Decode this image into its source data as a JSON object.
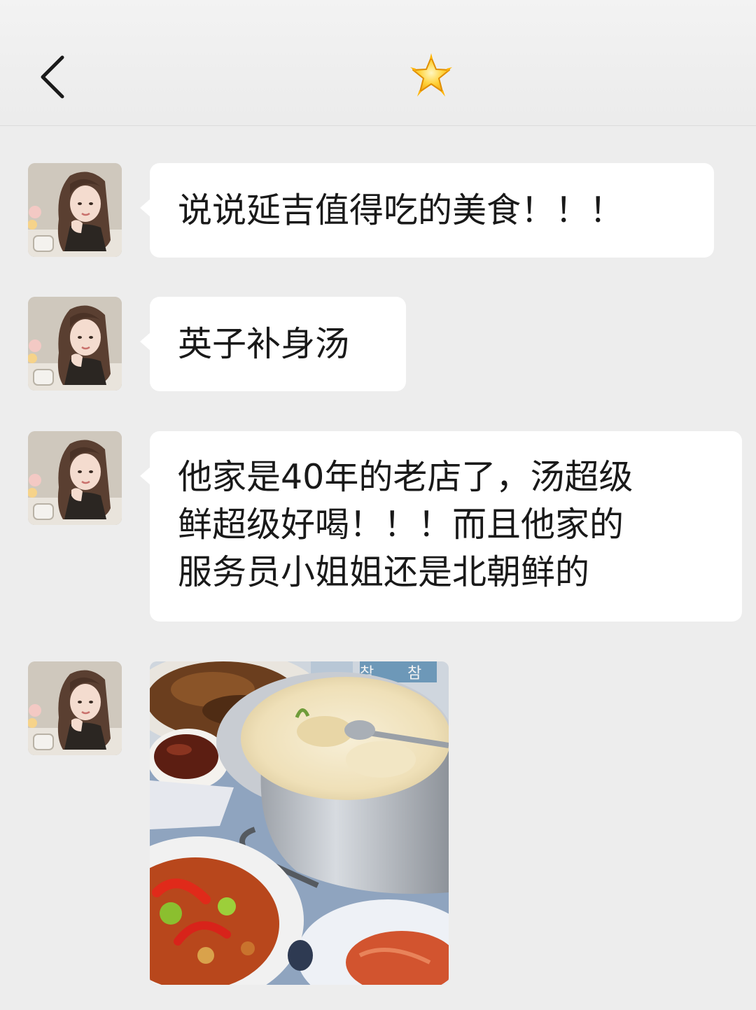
{
  "header": {
    "title_icon": "glowing-star-icon",
    "back_icon": "chevron-left-icon"
  },
  "messages": [
    {
      "type": "text",
      "text": "说说延吉值得吃的美食！！！"
    },
    {
      "type": "text",
      "text": "英子补身汤"
    },
    {
      "type": "text",
      "lines": [
        "他家是40年的老店了，汤超级",
        "鲜超级好喝！！！而且他家的",
        "服务员小姐姐还是北朝鲜的"
      ]
    },
    {
      "type": "image",
      "image_icon": "food-photo-hotpot-soup",
      "printed_text": "참"
    }
  ]
}
